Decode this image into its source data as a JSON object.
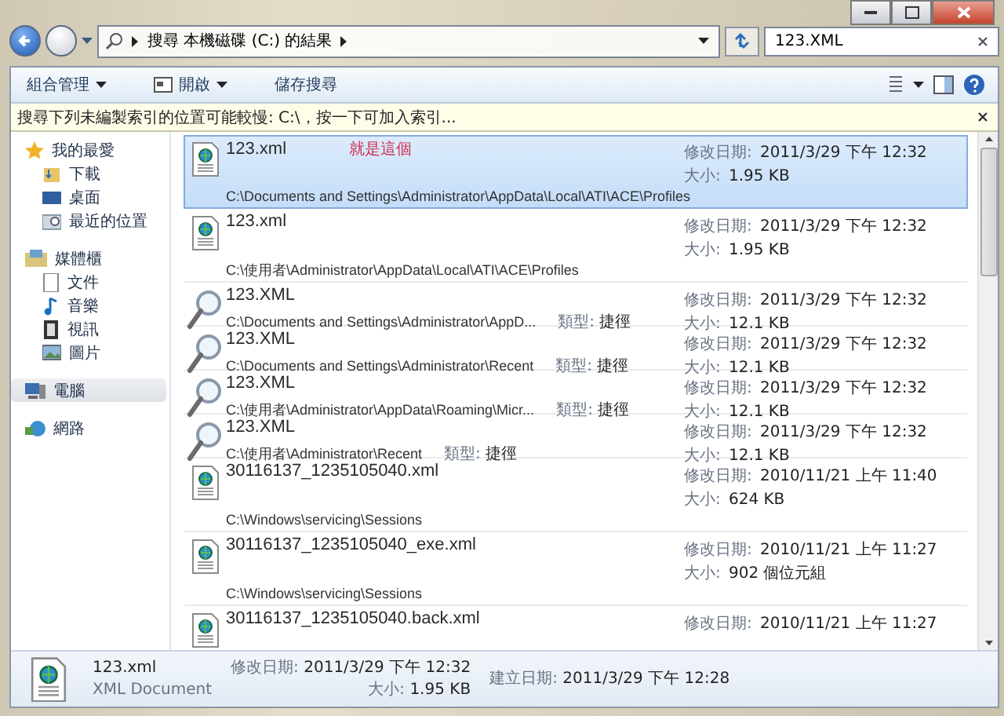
{
  "address_bar": {
    "breadcrumbs": [
      "搜尋 本機磁碟 (C:) 的結果"
    ]
  },
  "search": {
    "value": "123.XML"
  },
  "toolbar": {
    "buttons": [
      {
        "label": "組合管理",
        "kind": "menu"
      },
      {
        "label": "開啟",
        "kind": "app-menu"
      },
      {
        "label": "儲存搜尋",
        "kind": "plain"
      }
    ]
  },
  "info_bar": {
    "text": "搜尋下列未編製索引的位置可能較慢: C:\\，按一下可加入索引..."
  },
  "sidebar": {
    "groups": [
      {
        "label": "我的最愛",
        "selected": false,
        "children": [
          {
            "label": "下載"
          },
          {
            "label": "桌面"
          },
          {
            "label": "最近的位置"
          }
        ]
      },
      {
        "label": "媒體櫃",
        "selected": false,
        "children": [
          {
            "label": "文件"
          },
          {
            "label": "音樂"
          },
          {
            "label": "視訊"
          },
          {
            "label": "圖片"
          }
        ]
      },
      {
        "label": "電腦",
        "selected": true
      },
      {
        "label": "網路",
        "selected": false
      }
    ]
  },
  "results": [
    {
      "kind": "xml",
      "selected": true,
      "name": "123.xml",
      "note": "就是這個",
      "path": "C:\\Documents and Settings\\Administrator\\AppData\\Local\\ATI\\ACE\\Profiles",
      "modified_label": "修改日期:",
      "modified": "2011/3/29 下午 12:32",
      "size_label": "大小:",
      "size": "1.95 KB"
    },
    {
      "kind": "xml",
      "selected": false,
      "name": "123.xml",
      "path": "C:\\使用者\\Administrator\\AppData\\Local\\ATI\\ACE\\Profiles",
      "modified_label": "修改日期:",
      "modified": "2011/3/29 下午 12:32",
      "size_label": "大小:",
      "size": "1.95 KB"
    },
    {
      "kind": "shortcut",
      "selected": false,
      "name": "123.XML",
      "path": "C:\\Documents and Settings\\Administrator\\AppD...",
      "type_label": "類型:",
      "type": "捷徑",
      "modified_label": "修改日期:",
      "modified": "2011/3/29 下午 12:32",
      "size_label": "大小:",
      "size": "12.1 KB"
    },
    {
      "kind": "shortcut",
      "selected": false,
      "name": "123.XML",
      "path": "C:\\Documents and Settings\\Administrator\\Recent",
      "type_label": "類型:",
      "type": "捷徑",
      "modified_label": "修改日期:",
      "modified": "2011/3/29 下午 12:32",
      "size_label": "大小:",
      "size": "12.1 KB"
    },
    {
      "kind": "shortcut",
      "selected": false,
      "name": "123.XML",
      "path": "C:\\使用者\\Administrator\\AppData\\Roaming\\Micr...",
      "type_label": "類型:",
      "type": "捷徑",
      "modified_label": "修改日期:",
      "modified": "2011/3/29 下午 12:32",
      "size_label": "大小:",
      "size": "12.1 KB"
    },
    {
      "kind": "shortcut",
      "selected": false,
      "name": "123.XML",
      "path": "C:\\使用者\\Administrator\\Recent",
      "type_label": "類型:",
      "type": "捷徑",
      "modified_label": "修改日期:",
      "modified": "2011/3/29 下午 12:32",
      "size_label": "大小:",
      "size": "12.1 KB"
    },
    {
      "kind": "xml",
      "selected": false,
      "name": "30116137_1235105040.xml",
      "path": "C:\\Windows\\servicing\\Sessions",
      "modified_label": "修改日期:",
      "modified": "2010/11/21 上午 11:40",
      "size_label": "大小:",
      "size": "624 KB"
    },
    {
      "kind": "xml",
      "selected": false,
      "name": "30116137_1235105040_exe.xml",
      "path": "C:\\Windows\\servicing\\Sessions",
      "modified_label": "修改日期:",
      "modified": "2010/11/21 上午 11:27",
      "size_label": "大小:",
      "size": "902 個位元組"
    },
    {
      "kind": "xml",
      "selected": false,
      "name": "30116137_1235105040.back.xml",
      "modified_label": "修改日期:",
      "modified": "2010/11/21 上午 11:27"
    }
  ],
  "details": {
    "name": "123.xml",
    "type": "XML Document",
    "modified_label": "修改日期:",
    "modified": "2011/3/29 下午 12:32",
    "size_label": "大小:",
    "size": "1.95 KB",
    "created_label": "建立日期:",
    "created": "2011/3/29 下午 12:28"
  }
}
